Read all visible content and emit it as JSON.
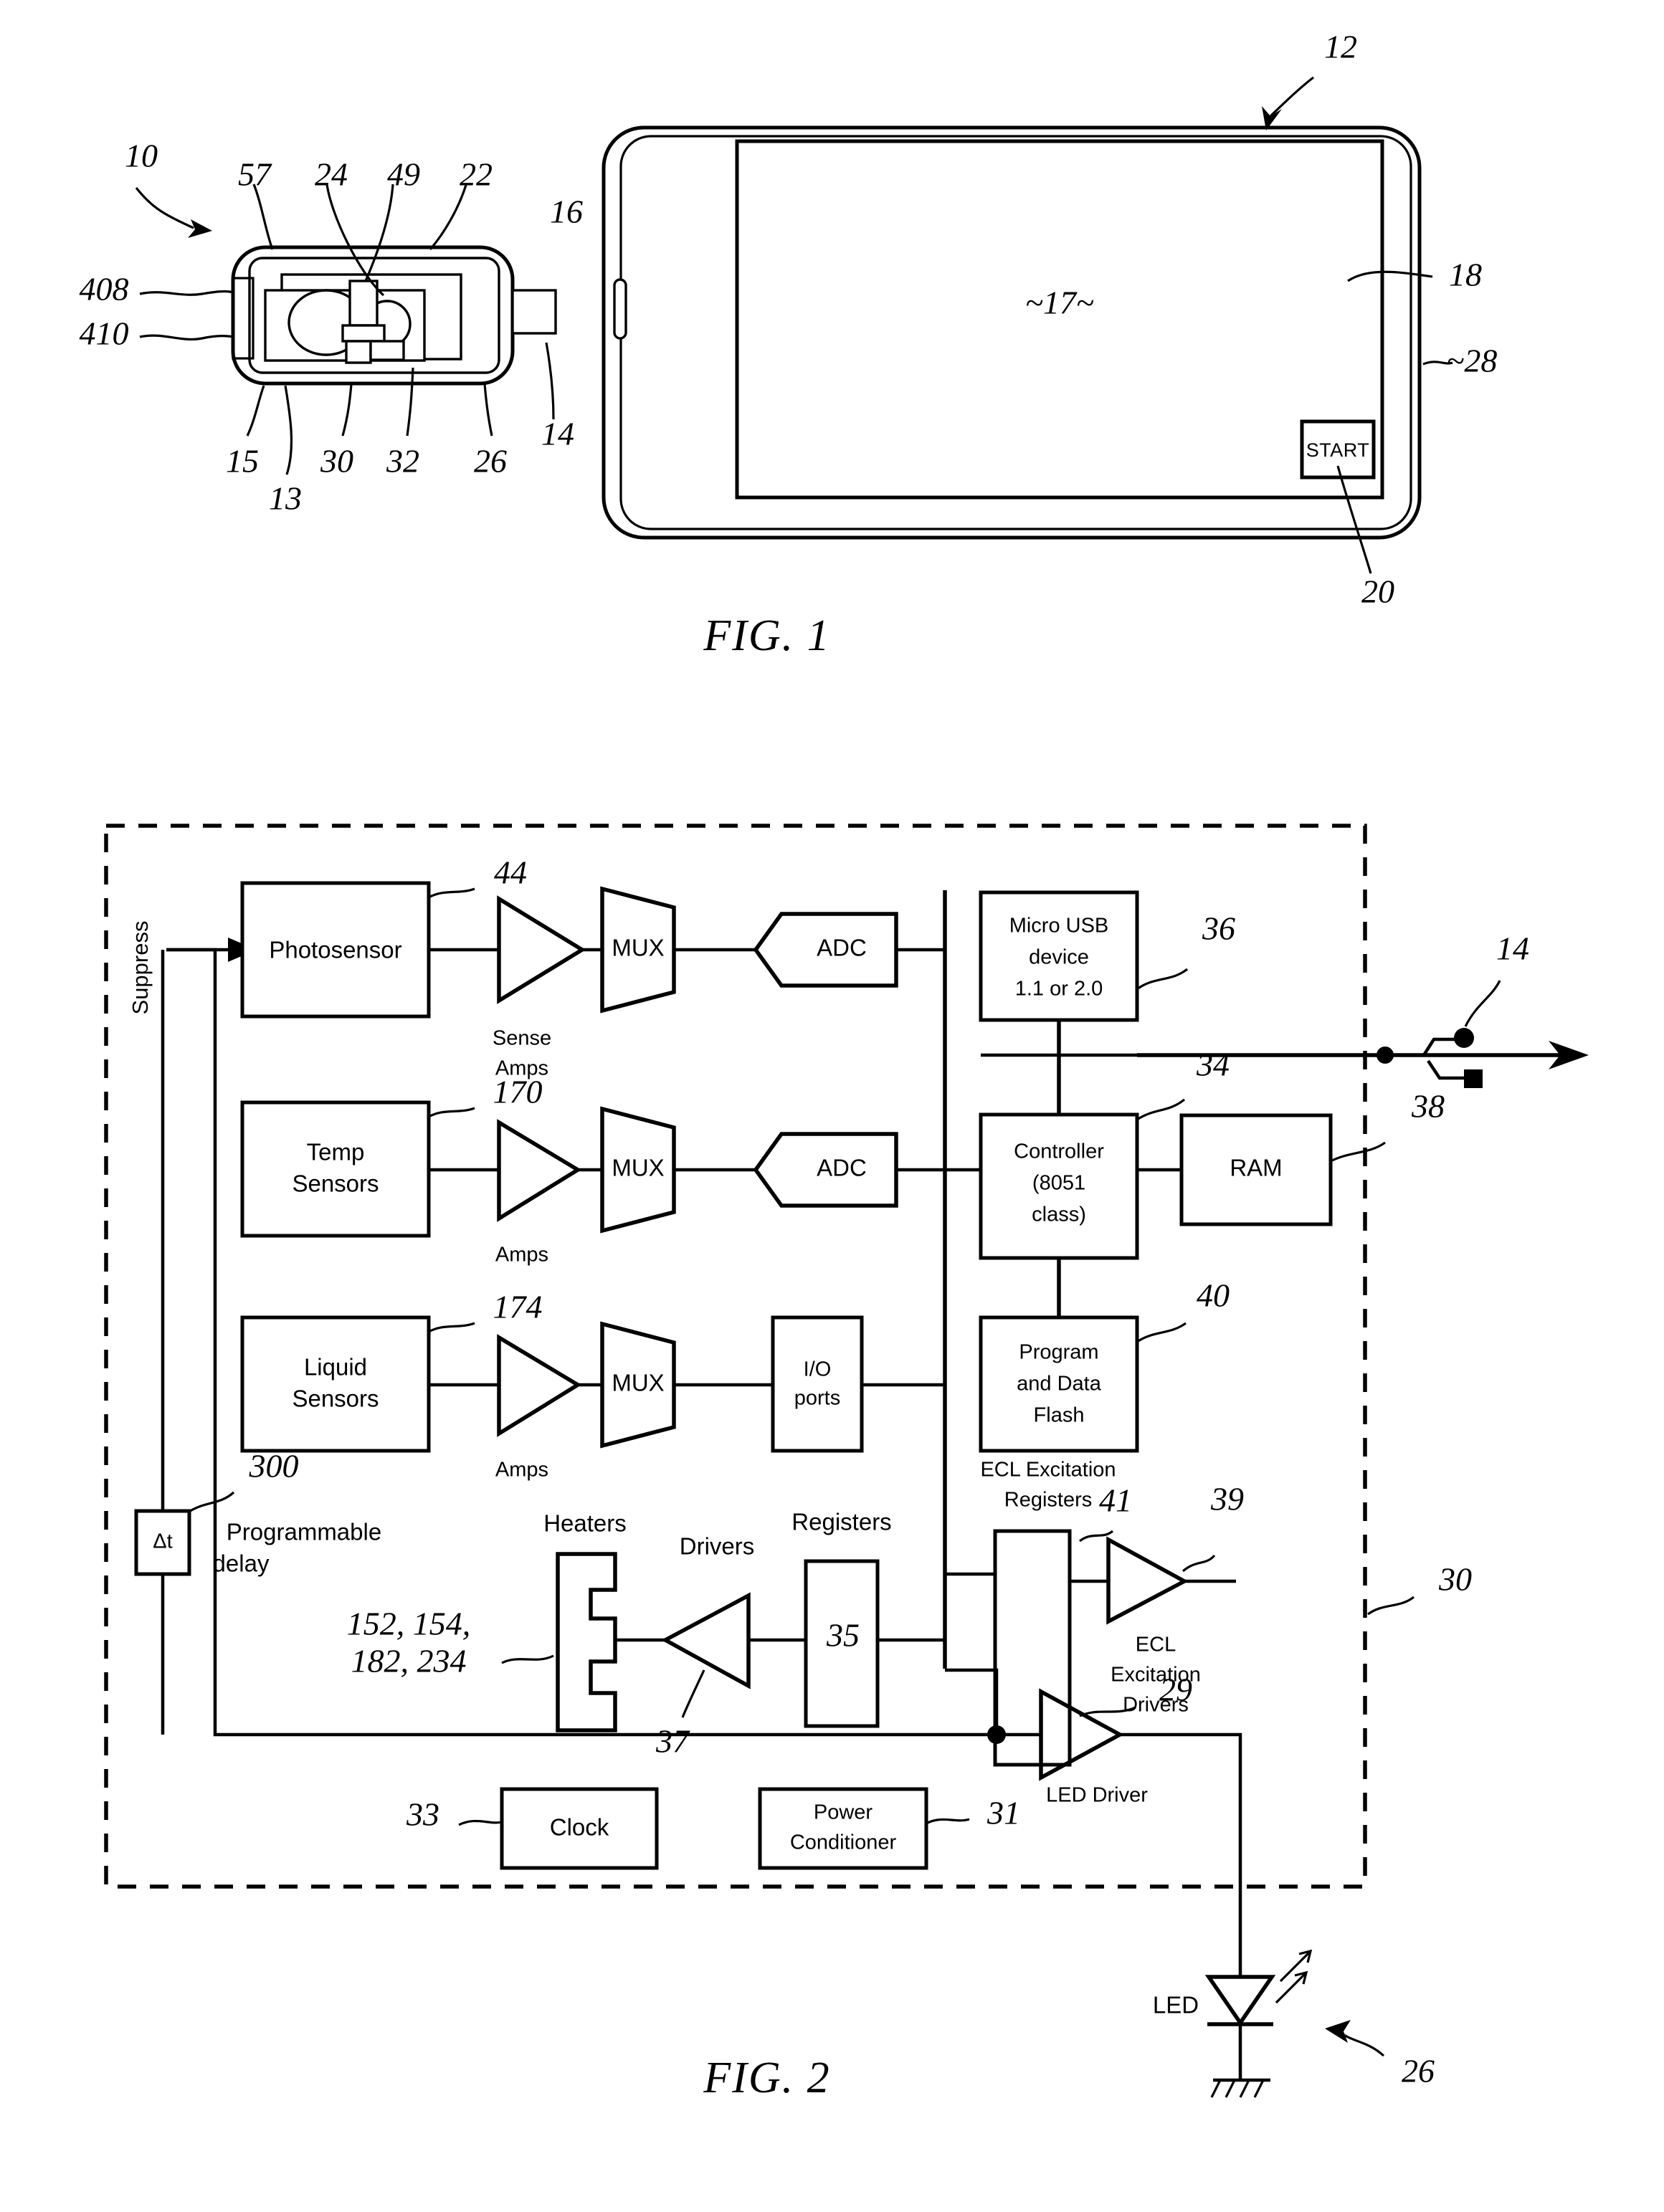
{
  "document": {
    "type": "patent-figure-sheet",
    "figures": [
      {
        "caption": "FIG. 1"
      },
      {
        "caption": "FIG. 2"
      }
    ]
  },
  "fig1": {
    "caption": "FIG. 1",
    "screen_label": "~17~",
    "start_button": "START",
    "reference_numerals": {
      "assembly": "10",
      "phone": "12",
      "cartridge_connector": "14",
      "phone_port": "16",
      "screen_content": "~17~",
      "display": "18",
      "start_button": "20",
      "lab_on_chip": "22",
      "window": "24",
      "led": "26",
      "phone_body": "~28",
      "support": "30",
      "photosensor": "32",
      "cartridge_outer": "408",
      "cartridge_inner": "410",
      "inlet": "15",
      "base": "13",
      "cap": "49",
      "lid": "57"
    },
    "numeral_list_top": [
      "10",
      "57",
      "24",
      "49",
      "22",
      "16",
      "12"
    ],
    "numeral_list_left": [
      "408",
      "410"
    ],
    "numeral_list_bottom": [
      "15",
      "30",
      "32",
      "26",
      "13",
      "14"
    ],
    "numeral_list_right": [
      "18",
      "~28",
      "20"
    ]
  },
  "fig2": {
    "caption": "FIG. 2",
    "suppress_label": "Suppress",
    "blocks": [
      {
        "id": "photosensor",
        "label": "Photosensor",
        "ref": "44"
      },
      {
        "id": "temp-sensors",
        "label": "Temp\nSensors",
        "ref": "170"
      },
      {
        "id": "liquid-sensors",
        "label": "Liquid\nSensors",
        "ref": "174"
      },
      {
        "id": "mux1",
        "label": "MUX"
      },
      {
        "id": "mux2",
        "label": "MUX"
      },
      {
        "id": "mux3",
        "label": "MUX"
      },
      {
        "id": "adc1",
        "label": "ADC"
      },
      {
        "id": "adc2",
        "label": "ADC"
      },
      {
        "id": "io-ports",
        "label": "I/O\nports"
      },
      {
        "id": "micro-usb",
        "label": "Micro USB\ndevice\n1.1 or 2.0",
        "ref": "36"
      },
      {
        "id": "controller",
        "label": "Controller\n(8051\nclass)",
        "ref": "34"
      },
      {
        "id": "ram",
        "label": "RAM",
        "ref": "38"
      },
      {
        "id": "program-flash",
        "label": "Program\nand Data\nFlash",
        "ref": "40"
      },
      {
        "id": "programmable-delay",
        "label": "Programmable\ndelay",
        "symbol": "Δt",
        "ref": "300"
      },
      {
        "id": "heaters",
        "label": "Heaters",
        "ref": "152, 154,\n182, 234"
      },
      {
        "id": "registers",
        "label": "Registers",
        "ref": "35"
      },
      {
        "id": "ecl-registers",
        "label": "ECL Excitation\nRegisters"
      },
      {
        "id": "clock",
        "label": "Clock",
        "ref": "33"
      },
      {
        "id": "power-conditioner",
        "label": "Power\nConditioner",
        "ref": "31"
      },
      {
        "id": "led",
        "label": "LED",
        "ref": "26"
      }
    ],
    "amp_labels": {
      "sense_amps": "Sense\nAmps",
      "amps_temp": "Amps",
      "amps_liquid": "Amps",
      "drivers": "Drivers",
      "ecl_excitation_drivers": "ECL\nExcitation\nDrivers",
      "led_driver": "LED Driver"
    },
    "text": {
      "photosensor": "Photosensor",
      "temp_sensors_l1": "Temp",
      "temp_sensors_l2": "Sensors",
      "liquid_sensors_l1": "Liquid",
      "liquid_sensors_l2": "Sensors",
      "mux": "MUX",
      "adc": "ADC",
      "io_l1": "I/O",
      "io_l2": "ports",
      "usb_l1": "Micro USB",
      "usb_l2": "device",
      "usb_l3": "1.1 or 2.0",
      "ctrl_l1": "Controller",
      "ctrl_l2": "(8051",
      "ctrl_l3": "class)",
      "ram": "RAM",
      "flash_l1": "Program",
      "flash_l2": "and Data",
      "flash_l3": "Flash",
      "delay_symbol": "Δt",
      "delay_l1": "Programmable",
      "delay_l2": "delay",
      "heaters": "Heaters",
      "registers": "Registers",
      "ecl_reg_l1": "ECL Excitation",
      "ecl_reg_l2": "Registers",
      "clock": "Clock",
      "power_l1": "Power",
      "power_l2": "Conditioner",
      "led": "LED",
      "sense_l1": "Sense",
      "sense_l2": "Amps",
      "amps": "Amps",
      "drivers": "Drivers",
      "ecl_drv_l1": "ECL",
      "ecl_drv_l2": "Excitation",
      "ecl_drv_l3": "Drivers",
      "led_driver": "LED Driver",
      "suppress": "Suppress"
    },
    "reference_numerals": {
      "sense_amps": "44",
      "temp_sensors": "170",
      "liquid_sensors": "174",
      "micro_usb": "36",
      "controller": "34",
      "ram": "38",
      "flash": "40",
      "programmable_delay": "300",
      "heaters": "152, 154,",
      "heaters_2": "182, 234",
      "drivers": "37",
      "registers": "35",
      "ecl_drivers_amp": "41",
      "ecl_drivers_out": "39",
      "led_driver": "29",
      "clock": "33",
      "power_conditioner": "31",
      "led": "26",
      "boundary": "30",
      "usb_connector": "14"
    }
  }
}
